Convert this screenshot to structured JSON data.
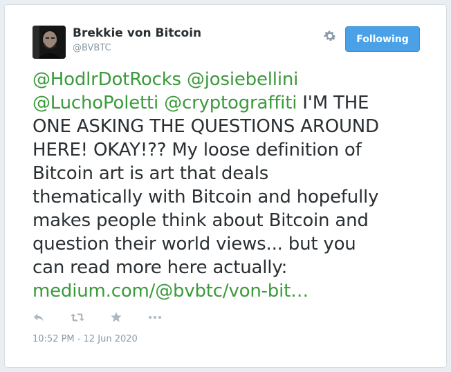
{
  "user": {
    "display_name": "Brekkie von Bitcoin",
    "handle": "@BVBTC",
    "avatar_icon": "avatar-photo"
  },
  "header": {
    "follow_label": "Following",
    "settings_icon": "gear-icon"
  },
  "tweet": {
    "mention_1": "@HodlrDotRocks",
    "mention_2": "@josiebellini",
    "mention_3": "@LuchoPoletti",
    "mention_4": "@cryptograffiti",
    "text_1": " I'M THE",
    "text_2": "ONE ASKING THE QUESTIONS AROUND",
    "text_3": "HERE! OKAY!?? My loose definition of",
    "text_4": "Bitcoin art is art that deals",
    "text_5": "thematically with Bitcoin and hopefully",
    "text_6": "makes people think about Bitcoin and",
    "text_7": "question their world views... but you",
    "text_8": "can read more here actually:",
    "link": "medium.com/@bvbtc/von-bit…"
  },
  "actions": [
    "reply-icon",
    "retweet-icon",
    "favorite-icon",
    "more-icon"
  ],
  "timestamp": "10:52 PM - 12 Jun 2020",
  "colors": {
    "link": "#3b9a3b",
    "follow_button": "#4aa1e8",
    "text": "#292f33",
    "muted": "#8899a6"
  }
}
